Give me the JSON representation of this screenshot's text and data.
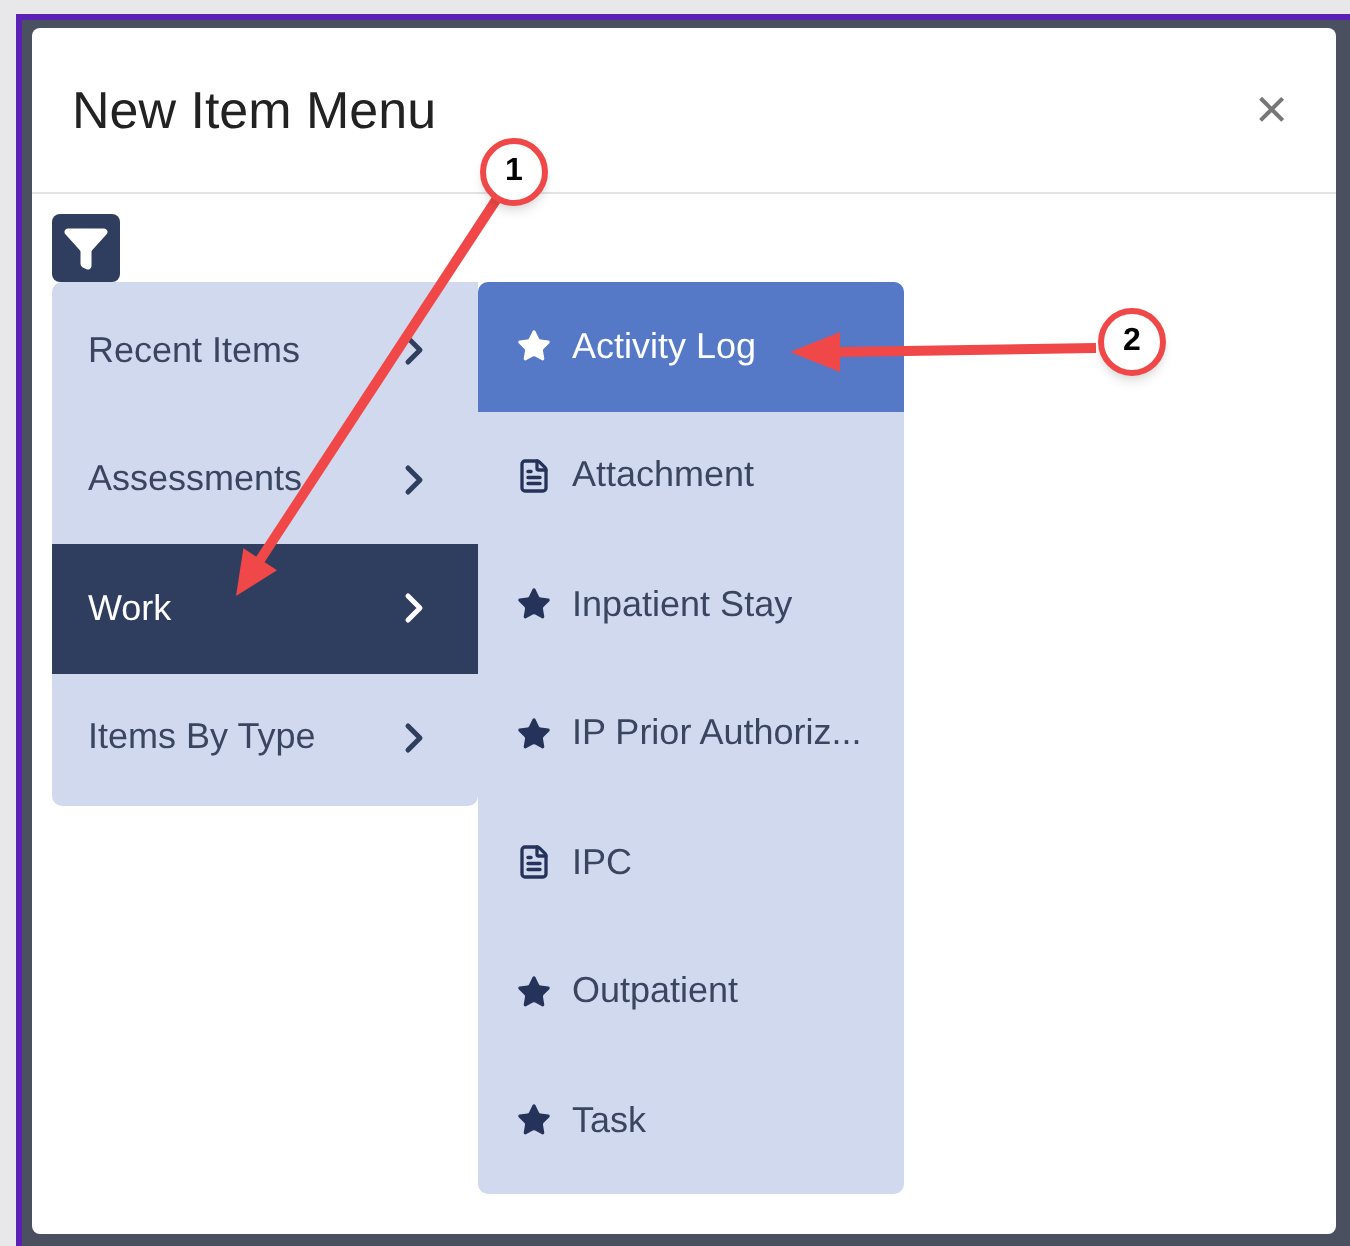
{
  "dialog": {
    "title": "New Item Menu",
    "close": "×"
  },
  "menu": [
    {
      "label": "Recent Items",
      "selected": false
    },
    {
      "label": "Assessments",
      "selected": false
    },
    {
      "label": "Work",
      "selected": true
    },
    {
      "label": "Items By Type",
      "selected": false
    }
  ],
  "submenu": [
    {
      "label": "Activity Log",
      "kind": "star",
      "selected": true
    },
    {
      "label": "Attachment",
      "kind": "document",
      "selected": false
    },
    {
      "label": "Inpatient Stay",
      "kind": "star",
      "selected": false
    },
    {
      "label": "IP Prior Authoriz...",
      "kind": "star",
      "selected": false
    },
    {
      "label": "IPC",
      "kind": "document",
      "selected": false
    },
    {
      "label": "Outpatient",
      "kind": "star",
      "selected": false
    },
    {
      "label": "Task",
      "kind": "star",
      "selected": false
    }
  ],
  "callouts": [
    "1",
    "2"
  ]
}
